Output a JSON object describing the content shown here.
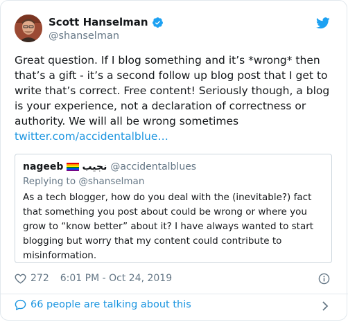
{
  "author": {
    "display_name": "Scott Hanselman",
    "handle": "@shanselman",
    "verified": true
  },
  "icons": {
    "avatar": "avatar-photo",
    "verified": "verified-badge-icon",
    "brand": "twitter-bird-icon",
    "like": "heart-icon",
    "info": "info-icon",
    "reply": "speech-bubble-icon",
    "chevron": "chevron-right-icon"
  },
  "colors": {
    "link": "#1b95e0",
    "muted": "#657786",
    "text": "#14171a",
    "border": "#e1e8ed"
  },
  "tweet": {
    "text": "Great question. If I blog something and it’s *wrong* then that’s a gift - it’s a second follow up blog post that I get to write that’s correct. Free content! Seriously though, a blog is your experience, not a declaration of correctness or authority. We will all be wrong sometimes",
    "link": "twitter.com/accidentalblue…"
  },
  "quoted": {
    "name": "nageeb",
    "name_arabic": "نجيب",
    "handle": "@accidentalblues",
    "replying_to": "Replying to @shanselman",
    "text": "As a tech blogger, how do you deal with the (inevitable?) fact that something you post about could be wrong or where you grow to “know better” about it? I have always wanted to start blogging but worry that my content could contribute to misinformation."
  },
  "meta": {
    "likes": "272",
    "timestamp": "6:01 PM - Oct 24, 2019"
  },
  "conversation": {
    "label": "66 people are talking about this"
  }
}
